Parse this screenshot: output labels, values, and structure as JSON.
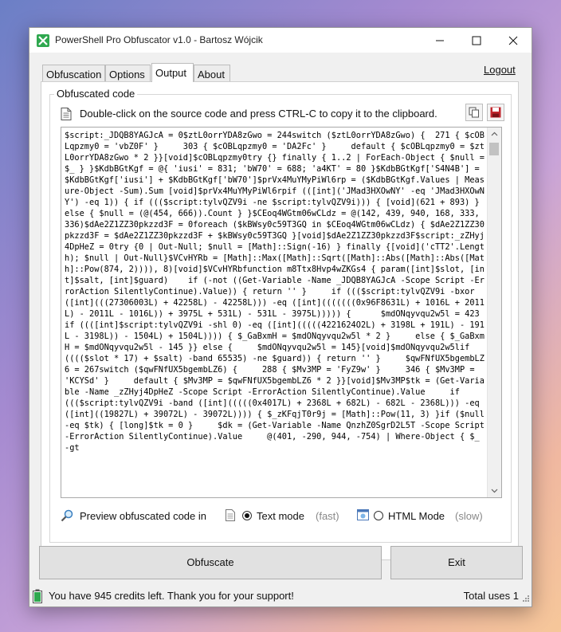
{
  "window": {
    "title": "PowerShell Pro Obfuscator v1.0 - Bartosz Wójcik"
  },
  "tabs": [
    {
      "label": "Obfuscation",
      "active": false
    },
    {
      "label": "Options",
      "active": false
    },
    {
      "label": "Output",
      "active": true
    },
    {
      "label": "About",
      "active": false
    }
  ],
  "logout_label": "Logout",
  "group": {
    "label": "Obfuscated code",
    "hint": "Double-click on the source code and press CTRL-C to copy it to the clipboard."
  },
  "code": "$script:_JDQB8YAGJcA = 0$ztL0orrYDA8zGwo = 244switch ($ztL0orrYDA8zGwo) {  271 { $cOBLqpzmy0 = 'vbZ0F' }     303 { $cOBLqpzmy0 = 'DA2Fc' }     default { $cOBLqpzmy0 = $ztL0orrYDA8zGwo * 2 }}[void]$cOBLqpzmy0try {} finally { 1..2 | ForEach-Object { $null = $_ } }$KdbBGtKgf = @{ 'iusi' = 831; 'bW70' = 688; 'a4KT' = 80 }$KdbBGtKgf['S4N4B'] = $KdbBGtKgf['iusi'] + $KdbBGtKgf['bW70']$prVx4MuYMyPiWl6rp = ($KdbBGtKgf.Values | Measure-Object -Sum).Sum [void]$prVx4MuYMyPiWl6rpif (([int]('JMad3HXOwNY' -eq 'JMad3HXOwNY') -eq 1)) { if ((($script:tylvQZV9i -ne $script:tylvQZV9i))) { [void](621 + 893) } else { $null = (@(454, 666)).Count } }$CEoq4WGtm06wCLdz = @(142, 439, 940, 168, 333, 336)$dAe2Z1ZZ30pkzzd3F = 0foreach ($kBWsy0c59T3GQ in $CEoq4WGtm06wCLdz) { $dAe2Z1ZZ30pkzzd3F = $dAe2Z1ZZ30pkzzd3F + $kBWsy0c59T3GQ }[void]$dAe2Z1ZZ30pkzzd3F$script:_zZHyj4DpHeZ = 0try {0 | Out-Null; $null = [Math]::Sign(-16) } finally {[void]('cTT2'.Length); $null | Out-Null}$VCvHYRb = [Math]::Max([Math]::Sqrt([Math]::Abs([Math]::Abs([Math]::Pow(874, 2)))), 8)[void]$VCvHYRbfunction m8Ttx8Hvp4wZKGs4 { param([int]$slot, [int]$salt, [int]$guard)    if (-not ((Get-Variable -Name _JDQB8YAGJcA -Scope Script -ErrorAction SilentlyContinue).Value)) { return '' }     if ((($script:tylvQZV9i -bxor ([int](((27306003L) + 42258L) - 42258L))) -eq ([int](((((((0x96F8631L) + 1016L + 2011L) - 2011L - 1016L)) + 3975L + 531L) - 531L - 3975L))))) {      $mdONqyvqu2w5l = 423     if ((([int]$script:tylvQZV9i -shl 0) -eq ([int](((((4221624O2L) + 3198L + 191L) - 191L - 3198L)) - 1504L) + 1504L)))) { $_GaBxmH = $mdONqyvqu2w5l * 2 }     else { $_GaBxmH = $mdONqyvqu2w5l - 145 }} else {     $mdONqyvqu2w5l = 145}[void]$mdONqyvqu2w5lif (((($slot * 17) + $salt) -band 65535) -ne $guard)) { return '' }     $qwFNfUX5bgembLZ6 = 267switch ($qwFNfUX5bgembLZ6) {     288 { $Mv3MP = 'FyZ9w' }     346 { $Mv3MP = 'KCYSd' }     default { $Mv3MP = $qwFNfUX5bgembLZ6 * 2 }}[void]$Mv3MP$tk = (Get-Variable -Name _zZHyj4DpHeZ -Scope Script -ErrorAction SilentlyContinue).Value     if ((($script:tylvQZV9i -band ([int](((((0x4017L) + 2368L + 682L) - 682L - 2368L))) -eq ([int]((19827L) + 39072L) - 39072L)))) { $_zKFqjT0r9j = [Math]::Pow(11, 3) }if ($null -eq $tk) { [long]$tk = 0 }     $dk = (Get-Variable -Name QnzhZ0SgrD2L5T -Scope Script -ErrorAction SilentlyContinue).Value     @(401, -290, 944, -754) | Where-Object { $_ -gt",
  "preview": {
    "label": "Preview obfuscated code in",
    "text_mode": "Text mode",
    "text_mode_note": "(fast)",
    "html_mode": "HTML Mode",
    "html_mode_note": "(slow)",
    "selected": "Text mode"
  },
  "buttons": {
    "obfuscate": "Obfuscate",
    "exit": "Exit"
  },
  "status": {
    "credits": "You have 945 credits left. Thank you for your support!",
    "uses": "Total uses 1"
  },
  "icons": {
    "app": "obfuscator-app-icon",
    "hint": "document-icon",
    "copy": "copy-icon",
    "save": "save-icon",
    "preview": "magnifier-icon",
    "text_mode": "text-file-icon",
    "html_mode": "browser-icon",
    "battery": "battery-icon"
  },
  "colors": {
    "accent": "#2fa84f",
    "save_icon": "#c0262d"
  }
}
